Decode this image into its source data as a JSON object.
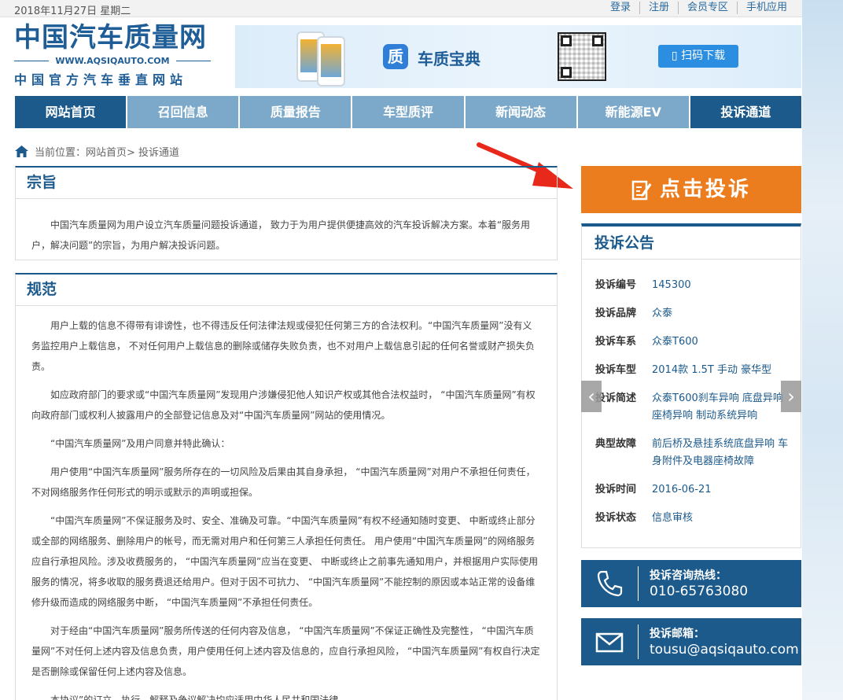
{
  "topbar": {
    "date": "2018年11月27日 星期二",
    "links": [
      "登录",
      "注册",
      "会员专区",
      "手机应用"
    ]
  },
  "logo": {
    "title": "中国汽车质量网",
    "url": "WWW.AQSIQAUTO.COM",
    "slogan": "中国官方汽车垂直网站"
  },
  "banner": {
    "app_icon_char": "质",
    "app_name": "车质宝典",
    "button": "扫码下载"
  },
  "nav": [
    "网站首页",
    "召回信息",
    "质量报告",
    "车型质评",
    "新闻动态",
    "新能源EV",
    "投诉通道"
  ],
  "breadcrumb": "当前位置：网站首页> 投诉通道",
  "section1": {
    "title": "宗旨",
    "paragraphs": [
      "中国汽车质量网为用户设立汽车质量问题投诉通道， 致力于为用户提供便捷高效的汽车投诉解决方案。本着“服务用户，解决问题”的宗旨，为用户解决投诉问题。"
    ]
  },
  "section2": {
    "title": "规范",
    "paragraphs": [
      "用户上载的信息不得带有诽谤性，也不得违反任何法律法规或侵犯任何第三方的合法权利。“中国汽车质量网”没有义务监控用户上载信息， 不对任何用户上载信息的删除或储存失败负责，也不对用户上载信息引起的任何名誉或财产损失负责。",
      "如应政府部门的要求或“中国汽车质量网”发现用户涉嫌侵犯他人知识产权或其他合法权益时， “中国汽车质量网”有权向政府部门或权利人披露用户的全部登记信息及对“中国汽车质量网”网站的使用情况。",
      "“中国汽车质量网”及用户同意并特此确认：",
      "用户使用“中国汽车质量网”服务所存在的一切风险及后果由其自身承担， “中国汽车质量网”对用户不承担任何责任， 不对网络服务作任何形式的明示或默示的声明或担保。",
      "“中国汽车质量网”不保证服务及时、安全、准确及可靠。“中国汽车质量网”有权不经通知随时变更、 中断或终止部分或全部的网络服务、删除用户的帐号，而无需对用户和任何第三人承担任何责任。 用户使用“中国汽车质量网”的网络服务应自行承担风险。涉及收费服务的， “中国汽车质量网”应当在变更、 中断或终止之前事先通知用户，并根据用户实际使用服务的情况，将多收取的服务费退还给用户。但对于因不可抗力、 “中国汽车质量网”不能控制的原因或本站正常的设备维修升级而造成的网络服务中断， “中国汽车质量网”不承担任何责任。",
      "对于经由“中国汽车质量网”服务所传送的任何内容及信息， “中国汽车质量网”不保证正确性及完整性， “中国汽车质量网”不对任何上述内容及信息负责，用户使用任何上述内容及信息的，应自行承担风险， “中国汽车质量网”有权自行决定是否删除或保留任何上述内容及信息。",
      "本协议”的订立、执行、解释及争议解决均应适用中华人民共和国法律。"
    ]
  },
  "cta": "点击投诉",
  "notice": {
    "title": "投诉公告",
    "rows": [
      {
        "k": "投诉编号",
        "v": "145300"
      },
      {
        "k": "投诉品牌",
        "v": "众泰"
      },
      {
        "k": "投诉车系",
        "v": "众泰T600"
      },
      {
        "k": "投诉车型",
        "v": "2014款 1.5T 手动 豪华型"
      },
      {
        "k": "投诉简述",
        "v": "众泰T600刹车异响 底盘异响 座椅异响 制动系统异响"
      },
      {
        "k": "典型故障",
        "v": "前后桥及悬挂系统底盘异响 车身附件及电器座椅故障"
      },
      {
        "k": "投诉时间",
        "v": "2016-06-21"
      },
      {
        "k": "投诉状态",
        "v": "信息审核"
      }
    ]
  },
  "hotline": {
    "label": "投诉咨询热线：",
    "value": "010-65763080"
  },
  "email": {
    "label": "投诉邮箱：",
    "value": "tousu@aqsiqauto.com"
  },
  "colors": {
    "brand": "#1c5a8c",
    "nav_inactive": "#7ca9c9",
    "cta": "#ec7d1f",
    "link": "#2b6a9e"
  }
}
